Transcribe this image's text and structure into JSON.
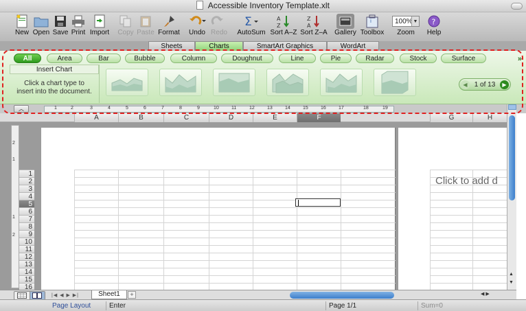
{
  "window": {
    "title": "Accessible Inventory Template.xlt"
  },
  "toolbar": {
    "new": "New",
    "open": "Open",
    "save": "Save",
    "print": "Print",
    "import": "Import",
    "copy": "Copy",
    "paste": "Paste",
    "format": "Format",
    "undo": "Undo",
    "redo": "Redo",
    "autosum": "AutoSum",
    "sort_az": "Sort A–Z",
    "sort_za": "Sort Z–A",
    "gallery": "Gallery",
    "toolbox": "Toolbox",
    "zoom": "Zoom",
    "zoom_value": "100%",
    "help": "Help"
  },
  "ribbon": {
    "tabs": [
      "Sheets",
      "Charts",
      "SmartArt Graphics",
      "WordArt"
    ],
    "active_tab": "Charts"
  },
  "chart_gallery": {
    "categories": [
      "All",
      "Area",
      "Bar",
      "Bubble",
      "Column",
      "Doughnut",
      "Line",
      "Pie",
      "Radar",
      "Stock",
      "Surface"
    ],
    "active_category": "All",
    "more_symbol": "»",
    "insert_title": "Insert Chart",
    "insert_hint_line1": "Click a chart type to",
    "insert_hint_line2": "insert into the document.",
    "pager_label": "1 of 13"
  },
  "ruler": {
    "marks": [
      "1",
      "2",
      "3",
      "4",
      "5",
      "6",
      "7",
      "8",
      "9",
      "10",
      "11",
      "12",
      "13",
      "14",
      "15",
      "16",
      "17",
      "18",
      "19"
    ]
  },
  "vertical_ruler": {
    "marks": [
      "2",
      "1",
      "1",
      "2"
    ]
  },
  "columns": [
    "A",
    "B",
    "C",
    "D",
    "E",
    "F",
    "G",
    "H"
  ],
  "selected_column": "F",
  "rows": [
    "1",
    "2",
    "3",
    "4",
    "5",
    "6",
    "7",
    "8",
    "9",
    "10",
    "11",
    "12",
    "13",
    "14",
    "15",
    "16"
  ],
  "selected_row": "5",
  "page2": {
    "add_header_text": "Click to add d"
  },
  "sheets": {
    "tabs": [
      "Sheet1"
    ],
    "add_symbol": "+"
  },
  "status": {
    "view": "Page Layout View",
    "mode": "Enter",
    "page": "Page 1/1",
    "sum": "Sum=0"
  },
  "colors": {
    "accent_green": "#2e9a1d",
    "selection_grey": "#7a7a7a",
    "scroll_blue": "#3c7fcc",
    "highlight_red": "#e02020"
  }
}
